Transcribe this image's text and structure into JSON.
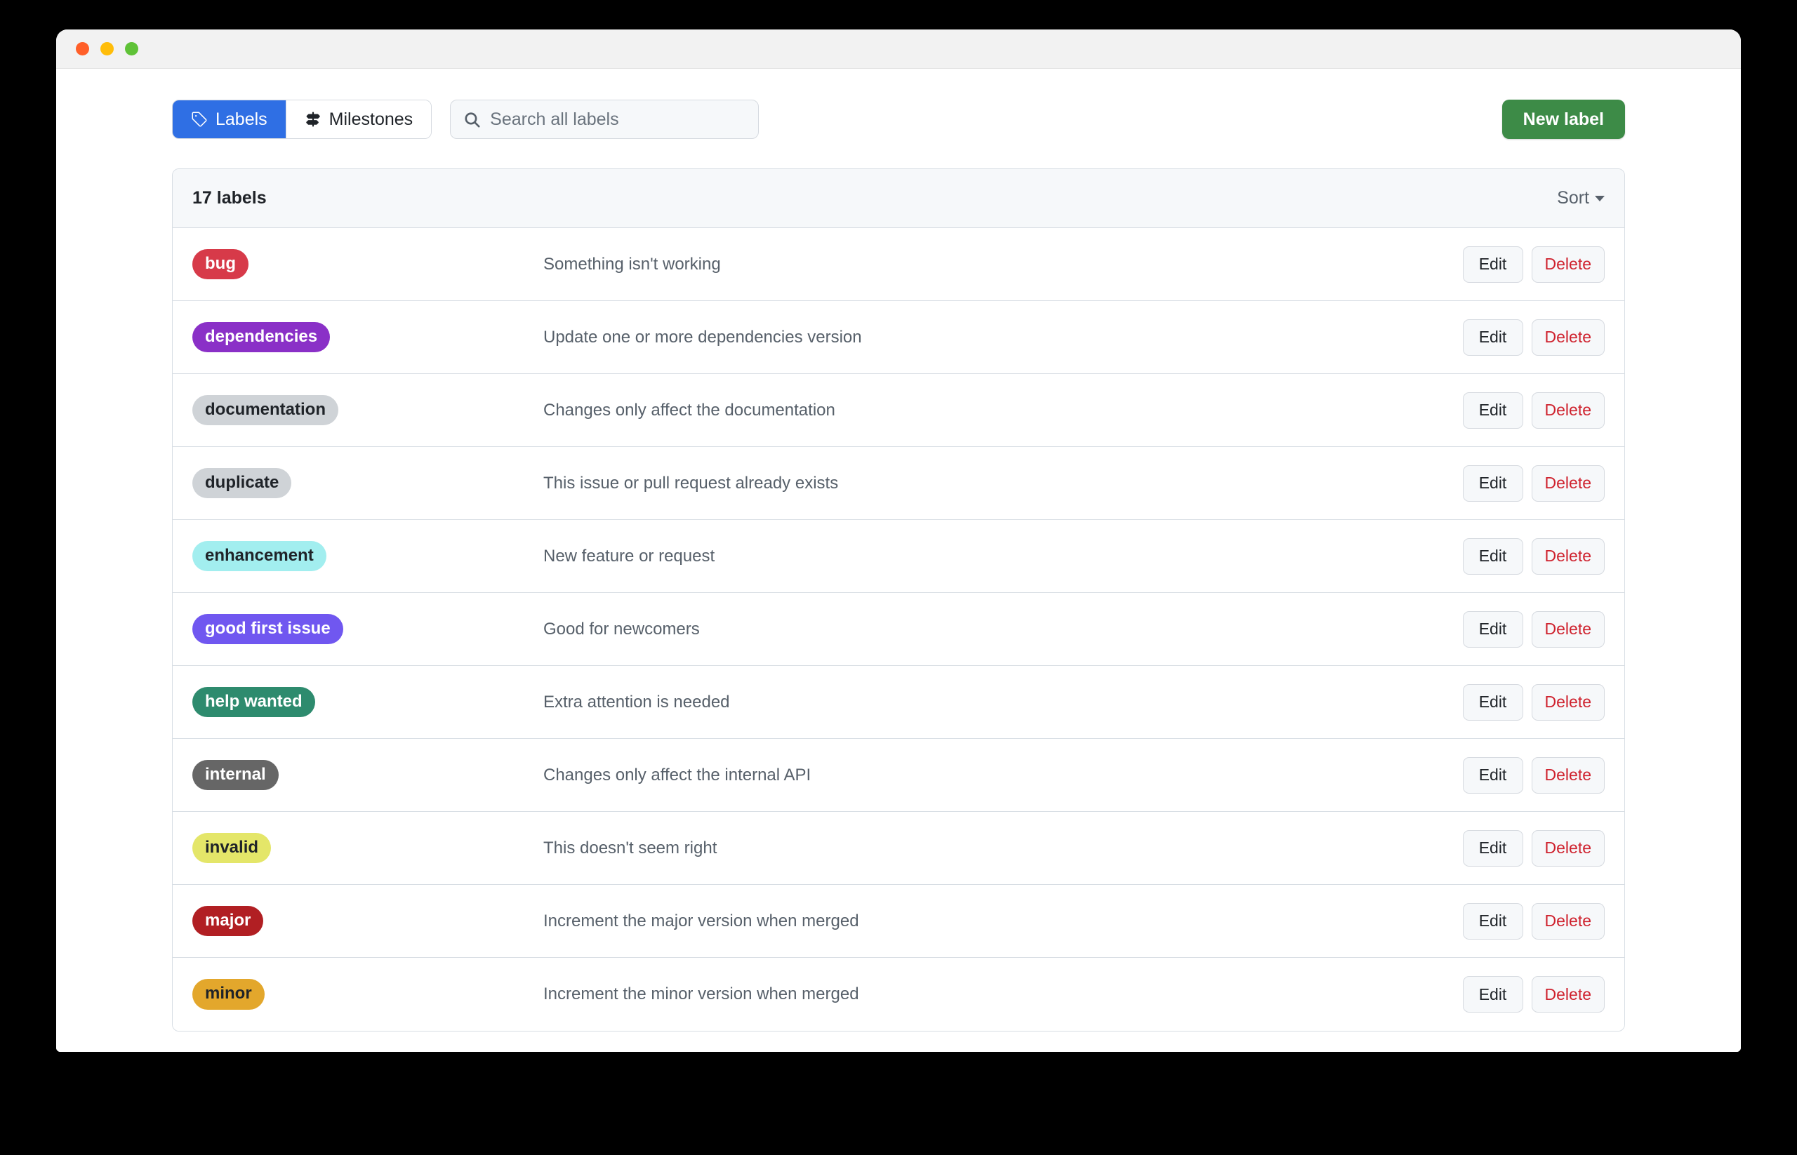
{
  "window": {
    "traffic_lights": [
      "close",
      "minimize",
      "zoom"
    ]
  },
  "toolbar": {
    "tabs": [
      {
        "label": "Labels",
        "icon": "tag-icon",
        "active": true
      },
      {
        "label": "Milestones",
        "icon": "milestone-icon",
        "active": false
      }
    ],
    "search": {
      "placeholder": "Search all labels",
      "value": "",
      "icon": "search-icon"
    },
    "new_label_button": "New label"
  },
  "list_header": {
    "count_text": "17 labels",
    "sort_label": "Sort"
  },
  "actions": {
    "edit": "Edit",
    "delete": "Delete"
  },
  "colors": {
    "accent_blue": "#2f6fe4",
    "green_button": "#3d8b47",
    "danger_red": "#cf222e",
    "card_border": "#d8dee4",
    "header_bg": "#f6f8fa"
  },
  "labels": [
    {
      "name": "bug",
      "description": "Something isn't working",
      "bg": "#d73a49",
      "fg": "#ffffff"
    },
    {
      "name": "dependencies",
      "description": "Update one or more dependencies version",
      "bg": "#8a30c7",
      "fg": "#ffffff"
    },
    {
      "name": "documentation",
      "description": "Changes only affect the documentation",
      "bg": "#cfd3d7",
      "fg": "#1f2328"
    },
    {
      "name": "duplicate",
      "description": "This issue or pull request already exists",
      "bg": "#cfd3d7",
      "fg": "#1f2328"
    },
    {
      "name": "enhancement",
      "description": "New feature or request",
      "bg": "#a2eeef",
      "fg": "#1f2328"
    },
    {
      "name": "good first issue",
      "description": "Good for newcomers",
      "bg": "#7057f0",
      "fg": "#ffffff"
    },
    {
      "name": "help wanted",
      "description": "Extra attention is needed",
      "bg": "#2e8b6e",
      "fg": "#ffffff"
    },
    {
      "name": "internal",
      "description": "Changes only affect the internal API",
      "bg": "#666666",
      "fg": "#ffffff"
    },
    {
      "name": "invalid",
      "description": "This doesn't seem right",
      "bg": "#e4e669",
      "fg": "#1f2328"
    },
    {
      "name": "major",
      "description": "Increment the major version when merged",
      "bg": "#b11f23",
      "fg": "#ffffff"
    },
    {
      "name": "minor",
      "description": "Increment the minor version when merged",
      "bg": "#e3a72c",
      "fg": "#1f2328"
    }
  ]
}
